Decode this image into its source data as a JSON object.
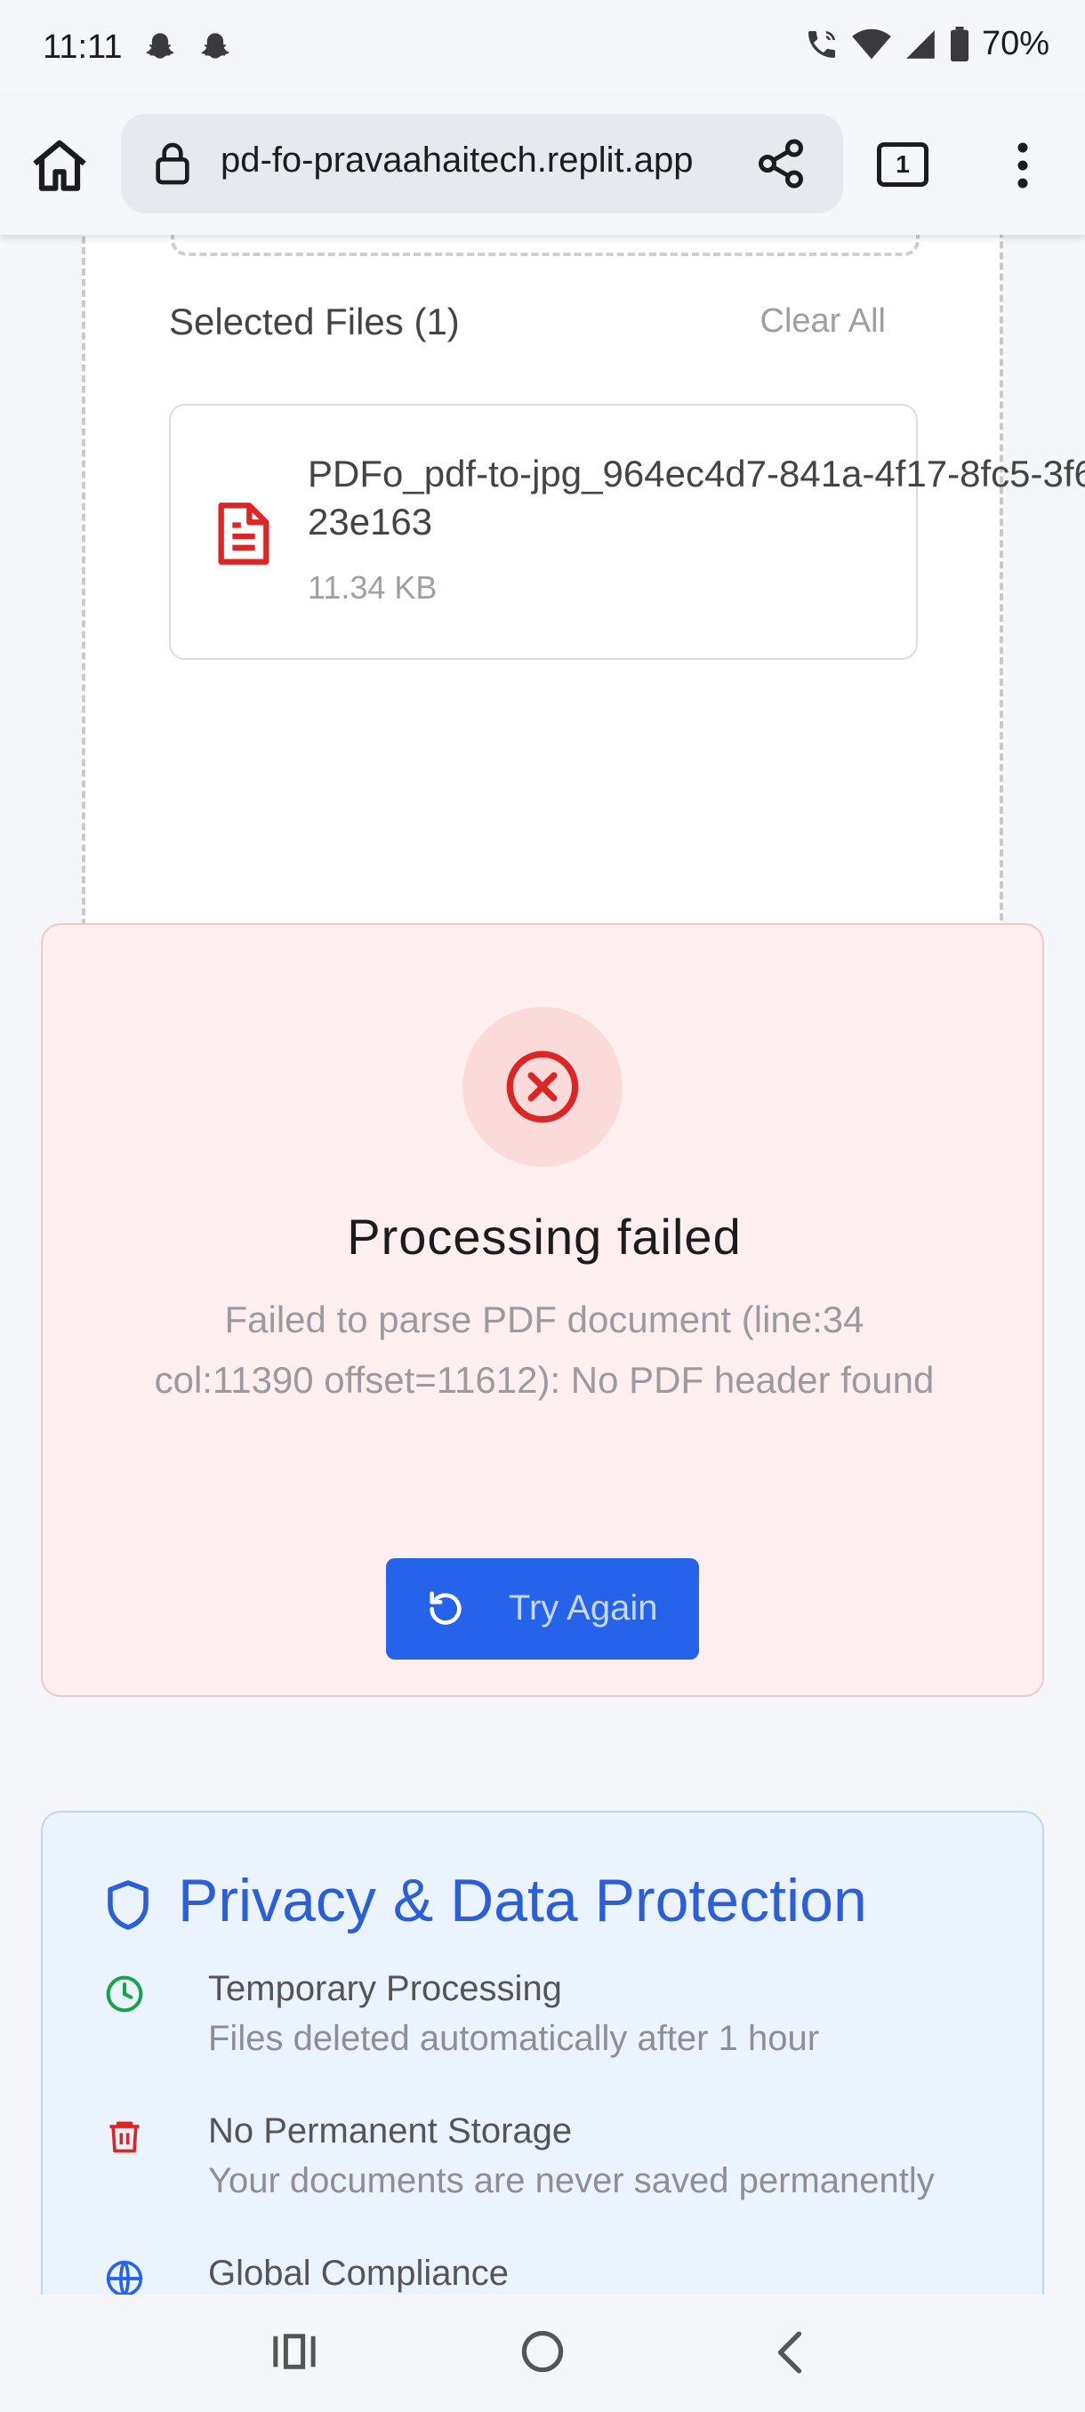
{
  "status_bar": {
    "time": "11:11",
    "battery": "70%",
    "notification_icons": [
      "snapchat-icon",
      "snapchat-icon"
    ],
    "system_icons": [
      "wifi-call-icon",
      "wifi-icon",
      "signal-icon",
      "battery-icon"
    ]
  },
  "browser": {
    "url": "pd-fo-pravaahaitech.replit.app",
    "tab_count": "1"
  },
  "upload": {
    "selected_files_label": "Selected Files (1)",
    "clear_all_label": "Clear All",
    "files": [
      {
        "name": "PDFo_pdf-to-jpg_964ec4d7-841a-4f17-8fc5-3f623e163",
        "size": "11.34 KB",
        "icon": "file-text-icon"
      }
    ]
  },
  "error": {
    "title": "Processing failed",
    "message": "Failed to parse PDF document (line:34 col:11390 offset=11612): No PDF header found",
    "retry_label": "Try Again",
    "colors": {
      "accent": "#dc2626",
      "button": "#2563eb"
    }
  },
  "privacy": {
    "title": "Privacy & Data Protection",
    "features": [
      {
        "title": "Temporary Processing",
        "desc": "Files deleted automatically after 1 hour",
        "icon": "clock-icon",
        "color": "#16a34a"
      },
      {
        "title": "No Permanent Storage",
        "desc": "Your documents are never saved permanently",
        "icon": "trash-icon",
        "color": "#dc2626"
      },
      {
        "title": "Global Compliance",
        "desc": "",
        "icon": "globe-icon",
        "color": "#2563eb"
      }
    ]
  }
}
